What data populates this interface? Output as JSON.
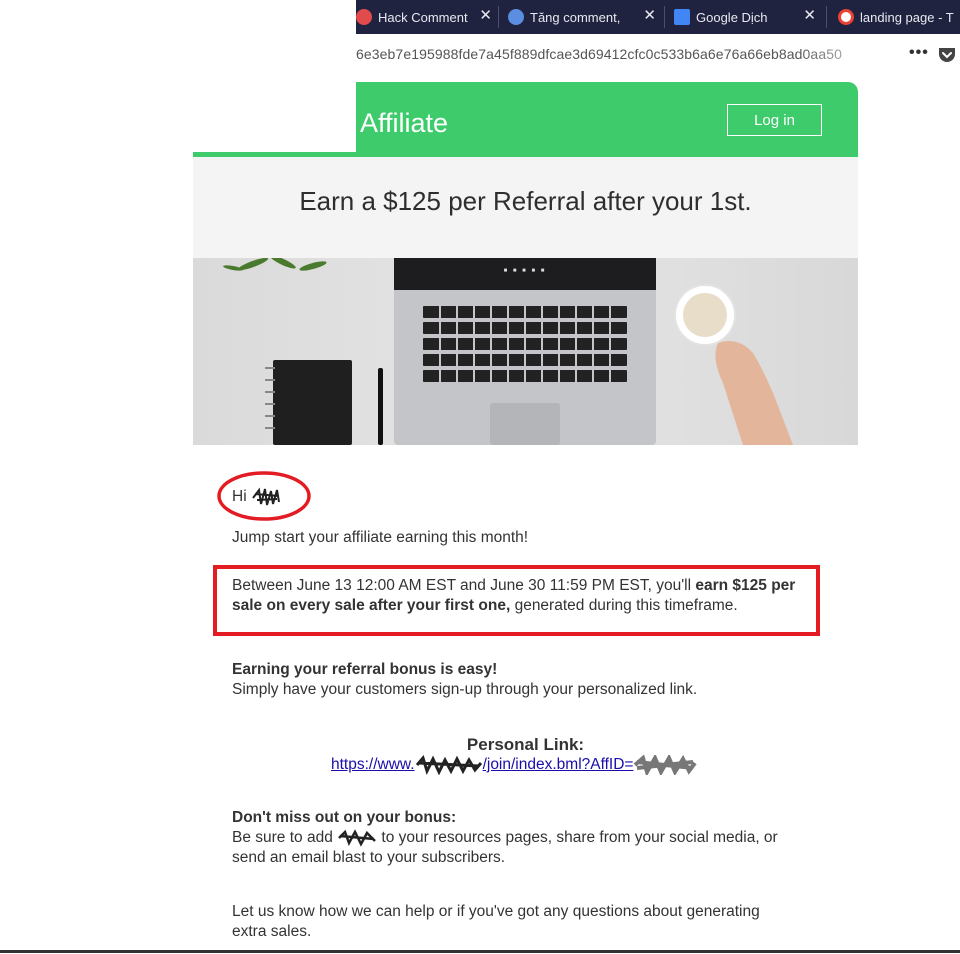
{
  "browser": {
    "tabs": [
      {
        "title": "Hack Comment",
        "icon": "red-circle-icon",
        "color": "#e24b4b"
      },
      {
        "title": "Tăng comment,",
        "icon": "blue-circle-icon",
        "color": "#5b8ee0"
      },
      {
        "title": "Google Dịch",
        "icon": "google-translate-icon",
        "color": "#4285f4"
      },
      {
        "title": "landing page - T",
        "icon": "google-icon",
        "color": "#ffffff"
      }
    ],
    "url": "6e3eb7e195988fde7a45f889dfcae3d69412cfc0c533b6a6e76a66eb8ad0aa50",
    "more_icon": "•••"
  },
  "email": {
    "brand": "Affiliate",
    "login_label": "Log in",
    "headline": "Earn a $125 per Referral after your 1st.",
    "greeting": "Hi",
    "intro": "Jump start your affiliate earning this month!",
    "promo": {
      "part1": "Between June 13 12:00 AM EST and June 30 11:59 PM EST, you'll ",
      "bold1": "earn $125 per",
      "bold2": "sale on every sale after your first one,",
      "part2": " generated during this timeframe."
    },
    "bonus_title": "Earning your referral bonus is easy!",
    "bonus_text": "Simply have your customers sign-up through your personalized link.",
    "personal_label": "Personal Link:",
    "personal_link_prefix": "https://www.",
    "personal_link_middle": "/join/index.bml?AffID=",
    "dont_miss_title": "Don't miss out on your bonus:",
    "dont_miss_line1_a": "Be sure to add ",
    "dont_miss_line1_b": " to your resources pages, share from your social media, or",
    "dont_miss_line2": "send an email blast to your subscribers.",
    "help_line1": "Let us know how we can help or if you've got any questions about generating",
    "help_line2": "extra sales."
  },
  "colors": {
    "header_green": "#3dcb6b",
    "annotation_red": "#e31b23",
    "tabstrip": "#202340",
    "link": "#1a0dab"
  }
}
